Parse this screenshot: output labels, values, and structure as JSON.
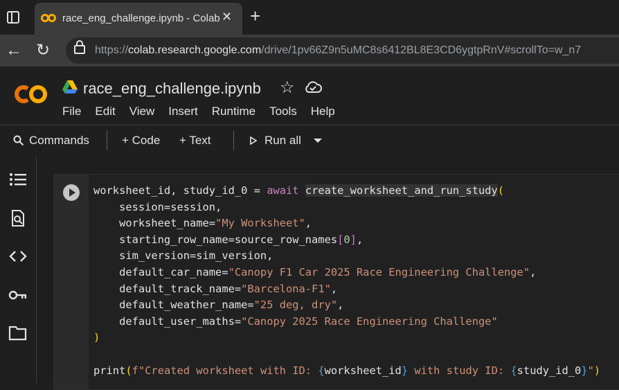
{
  "browser": {
    "tab_title": "race_eng_challenge.ipynb - Colab",
    "url_scheme": "https://",
    "url_host": "colab.research.google.com",
    "url_path": "/drive/1pv66Z9n5uMC8s6412BL8E3CD6ygtpRnV#scrollTo=w_n7"
  },
  "notebook": {
    "title": "race_eng_challenge.ipynb",
    "menu": [
      "File",
      "Edit",
      "View",
      "Insert",
      "Runtime",
      "Tools",
      "Help"
    ]
  },
  "toolbar": {
    "commands": "Commands",
    "code": "+ Code",
    "text": "+ Text",
    "run_all": "Run all"
  },
  "sidebar": {
    "icons": [
      "toc-icon",
      "find-icon",
      "code-snippets-icon",
      "secrets-key-icon",
      "files-folder-icon"
    ]
  },
  "cell": {
    "lines": [
      [
        {
          "t": "worksheet_id, study_id_0 = "
        },
        {
          "t": "await",
          "c": "kw"
        },
        {
          "t": " "
        },
        {
          "t": "create_worksheet_and_run_study",
          "c": "fn-hl"
        },
        {
          "t": "(",
          "c": "paren"
        }
      ],
      [
        {
          "t": "    session=session,"
        }
      ],
      [
        {
          "t": "    worksheet_name="
        },
        {
          "t": "\"My Worksheet\"",
          "c": "str"
        },
        {
          "t": ","
        }
      ],
      [
        {
          "t": "    starting_row_name=source_row_names"
        },
        {
          "t": "[",
          "c": "brack"
        },
        {
          "t": "0",
          "c": "num"
        },
        {
          "t": "]",
          "c": "brack"
        },
        {
          "t": ","
        }
      ],
      [
        {
          "t": "    sim_version=sim_version,"
        }
      ],
      [
        {
          "t": "    default_car_name="
        },
        {
          "t": "\"Canopy F1 Car 2025 Race Engineering Challenge\"",
          "c": "str"
        },
        {
          "t": ","
        }
      ],
      [
        {
          "t": "    default_track_name="
        },
        {
          "t": "\"Barcelona-F1\"",
          "c": "str"
        },
        {
          "t": ","
        }
      ],
      [
        {
          "t": "    default_weather_name="
        },
        {
          "t": "\"25 deg, dry\"",
          "c": "str"
        },
        {
          "t": ","
        }
      ],
      [
        {
          "t": "    default_user_maths="
        },
        {
          "t": "\"Canopy 2025 Race Engineering Challenge\"",
          "c": "str"
        }
      ],
      [
        {
          "t": ")",
          "c": "paren"
        }
      ],
      [
        {
          "t": ""
        }
      ],
      [
        {
          "t": "print"
        },
        {
          "t": "(",
          "c": "paren"
        },
        {
          "t": "f\"Created worksheet with ID: ",
          "c": "str"
        },
        {
          "t": "{",
          "c": "fstr-brace"
        },
        {
          "t": "worksheet_id"
        },
        {
          "t": "}",
          "c": "fstr-brace"
        },
        {
          "t": " with study ID: ",
          "c": "str"
        },
        {
          "t": "{",
          "c": "fstr-brace"
        },
        {
          "t": "study_id_0"
        },
        {
          "t": "}",
          "c": "fstr-brace"
        },
        {
          "t": "\"",
          "c": "str"
        },
        {
          "t": ")",
          "c": "paren"
        }
      ]
    ]
  }
}
